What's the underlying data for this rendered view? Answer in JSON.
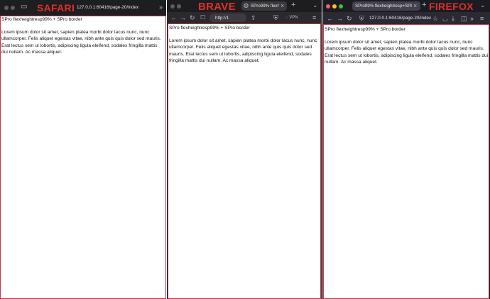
{
  "safari": {
    "brand": "SAFARI",
    "url": "127.0.0.1:60416/page-20/index",
    "page_title": "SPro flexheightresp99% + SPro border",
    "body": "Lorem ipsum dolor sit amet, sapien platea morbi dolor lacus nunc, nunc ullamcorper. Felis aliquet egestas vitae, nibh ante quis quis dolor sed mauris. Erat lectus sem ut lobortis, adipiscing ligula eleifend, sodales fringilla mattis dui nullam. Ac massa aliquet."
  },
  "brave": {
    "brand": "BRAVE",
    "tab_title": "SPro99% flexh",
    "url": "http://1",
    "vpn_label": "VPN",
    "page_title": "SPro flexheightresp99% + SPro border",
    "body": "Lorem ipsum dolor sit amet, sapien platea morbi dolor lacus nunc, nunc ullamcorper. Felis aliquet egestas vitae, nibh ante quis quis dolor sed mauris. Erat lectus sem ut lobortis, adipiscing ligula eleifend, sodales fringilla mattis dui nullam. Ac massa aliquet."
  },
  "firefox": {
    "brand": "FIREFOX",
    "tab_title": "SPro99% flexheightresp+SPborder",
    "url": "127.0.0.1:60416/page-20/index",
    "page_title": "SPro flexheightresp99% + SPro border",
    "body": "Lorem ipsum dolor sit amet, sapien platea morbi dolor lacus nunc, nunc ullamcorper. Felis aliquet egestas vitae, nibh ante quis quis dolor sed mauris. Erat lectus sem ut lobortis, adipiscing ligula eleifend, sodales fringilla mattis dui nullam. Ac massa aliquet."
  },
  "icons": {
    "close": "×",
    "plus": "+",
    "chevron": "»",
    "back": "←",
    "forward": "→",
    "reload": "↻",
    "sidebar": "▭",
    "shield": "⛨",
    "menu": "≡",
    "download": "⤓",
    "bookmark": "☐",
    "extensions": "◫",
    "chevron_down": "⌄",
    "share": "⇪"
  },
  "colors": {
    "chrome_dark": "#1e1e20",
    "tabbar_dark": "#2b2a33",
    "brand_red": "#e0302a",
    "border_red": "#c0384a",
    "traffic_red": "#ff5f57",
    "traffic_yellow": "#febc2e",
    "traffic_green": "#28c840"
  }
}
